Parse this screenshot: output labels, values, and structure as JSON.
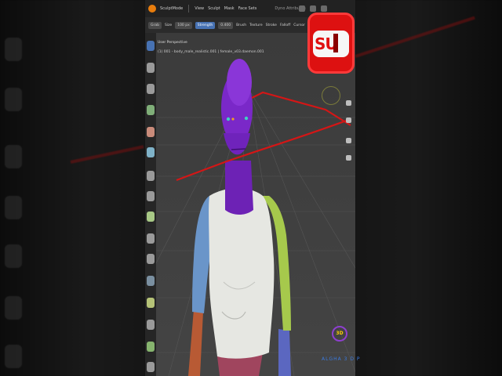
{
  "menubar": {
    "items": [
      "SculptMode",
      "View",
      "Sculpt",
      "Mask",
      "Face Sets"
    ],
    "center_field": "Dyno Attributes"
  },
  "toolbar": {
    "brush": "Grab",
    "size_label": "Size",
    "size_value": "100 px",
    "strength_label": "Strength",
    "strength_value": "0.400",
    "menus": [
      "Brush",
      "Texture",
      "Stroke",
      "Falloff",
      "Cursor"
    ]
  },
  "viewport": {
    "title": "User Perspective",
    "object_path": "(1) 001 - body_male_realistic.001 | female_v03.daemon.001"
  },
  "badge": {
    "text": "SU"
  },
  "watermark": {
    "logo": "3D",
    "text": "ALGHA 3 D P"
  },
  "colors": {
    "head": "#7a28c8",
    "torso": "#e6e7e2",
    "arm_left": "#6a95c9",
    "arm_right": "#a6c94c",
    "hip": "#a0455e",
    "accent": "#4772b3",
    "annotation": "#d41616"
  }
}
